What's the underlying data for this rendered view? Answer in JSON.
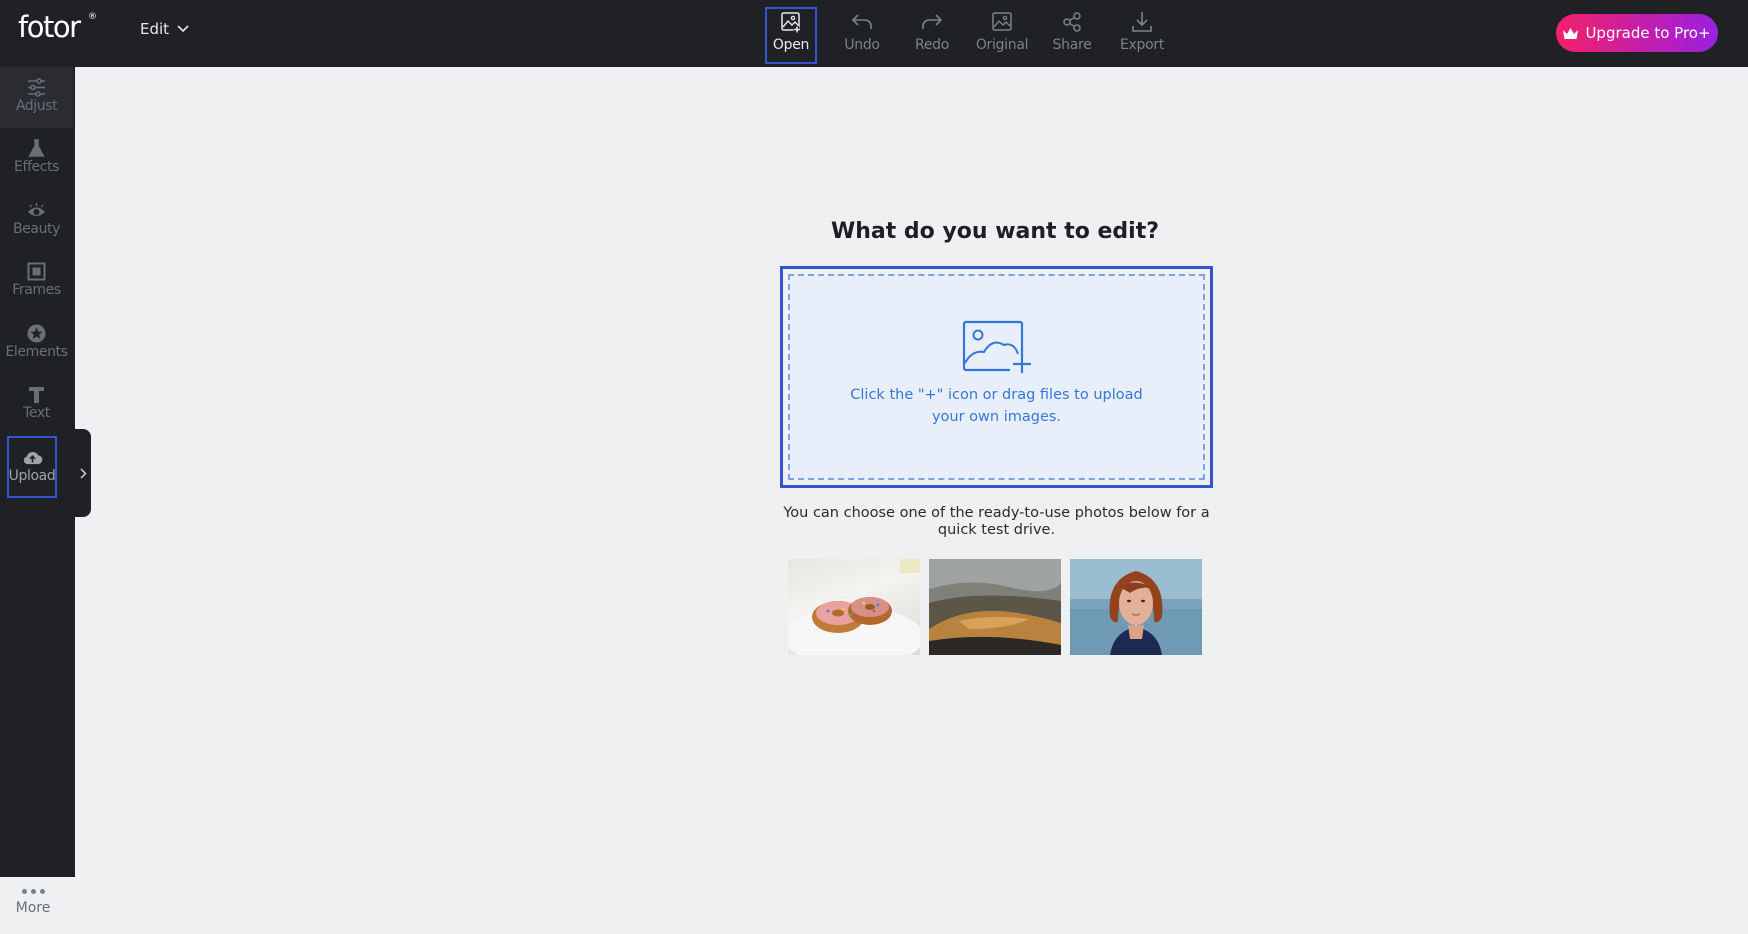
{
  "app": {
    "logo": "fotor",
    "logo_mark": "®",
    "menu_label": "Edit"
  },
  "toolbar": {
    "open": "Open",
    "undo": "Undo",
    "redo": "Redo",
    "original": "Original",
    "share": "Share",
    "export": "Export"
  },
  "upgrade": {
    "label": "Upgrade to Pro+"
  },
  "sidebar": {
    "items": [
      {
        "label": "Adjust",
        "icon": "sliders-icon"
      },
      {
        "label": "Effects",
        "icon": "flask-icon"
      },
      {
        "label": "Beauty",
        "icon": "eye-icon"
      },
      {
        "label": "Frames",
        "icon": "frame-icon"
      },
      {
        "label": "Elements",
        "icon": "star-icon"
      },
      {
        "label": "Text",
        "icon": "text-icon"
      },
      {
        "label": "Upload",
        "icon": "cloud-upload-icon"
      }
    ],
    "more": "More"
  },
  "main": {
    "heading": "What do you want to edit?",
    "drop_text": "Click the \"+\" icon or drag files to upload your own images.",
    "sample_text": "You can choose one of the ready-to-use photos below for a quick test drive."
  },
  "samples": [
    {
      "name": "donuts"
    },
    {
      "name": "landscape"
    },
    {
      "name": "portrait"
    }
  ],
  "colors": {
    "topbar_bg": "#1f2125",
    "canvas_bg": "#eff0f2",
    "highlight": "#3454d1",
    "drop_text": "#3477d9"
  }
}
